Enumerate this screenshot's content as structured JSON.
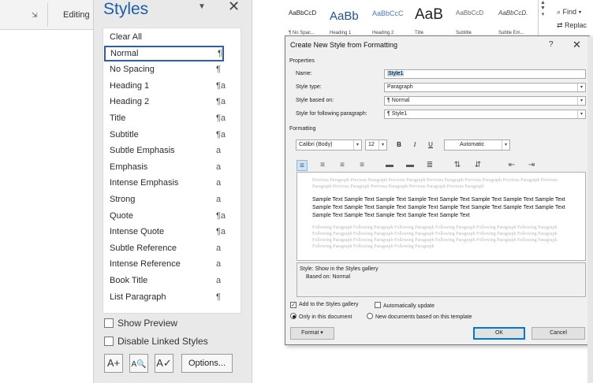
{
  "left_ribbon": {
    "editing_label": "Editing",
    "launcher_icon": "dialog-launcher-icon"
  },
  "styles_pane": {
    "title": "Styles",
    "caret": "▼",
    "close": "✕",
    "items": [
      {
        "label": "Clear All",
        "mark": ""
      },
      {
        "label": "Normal",
        "mark": "¶",
        "selected": true
      },
      {
        "label": "No Spacing",
        "mark": "¶"
      },
      {
        "label": "Heading 1",
        "mark": "¶a"
      },
      {
        "label": "Heading 2",
        "mark": "¶a"
      },
      {
        "label": "Title",
        "mark": "¶a"
      },
      {
        "label": "Subtitle",
        "mark": "¶a"
      },
      {
        "label": "Subtle Emphasis",
        "mark": "a"
      },
      {
        "label": "Emphasis",
        "mark": "a"
      },
      {
        "label": "Intense Emphasis",
        "mark": "a"
      },
      {
        "label": "Strong",
        "mark": "a"
      },
      {
        "label": "Quote",
        "mark": "¶a"
      },
      {
        "label": "Intense Quote",
        "mark": "¶a"
      },
      {
        "label": "Subtle Reference",
        "mark": "a"
      },
      {
        "label": "Intense Reference",
        "mark": "a"
      },
      {
        "label": "Book Title",
        "mark": "a"
      },
      {
        "label": "List Paragraph",
        "mark": "¶"
      }
    ],
    "show_preview": "Show Preview",
    "disable_linked": "Disable Linked Styles",
    "btn_new": "A+",
    "btn_inspect": "A🔍",
    "btn_manage": "A✓",
    "options": "Options..."
  },
  "ribbon": {
    "gallery": [
      {
        "sample": "AaBbCcD",
        "caption": "¶ No Spac..."
      },
      {
        "sample": "AaBb",
        "caption": "Heading 1"
      },
      {
        "sample": "AaBbCcC",
        "caption": "Heading 2"
      },
      {
        "sample": "AaB",
        "caption": "Title"
      },
      {
        "sample": "AaBbCcD",
        "caption": "Subtitle"
      },
      {
        "sample": "AaBbCcD.",
        "caption": "Subtle Em..."
      }
    ],
    "find": "Find",
    "replace": "Replac"
  },
  "dialog": {
    "title": "Create New Style from Formatting",
    "help": "?",
    "close": "✕",
    "properties_label": "Properties",
    "name_label": "Name:",
    "name_value": "Style1",
    "style_type_label": "Style type:",
    "style_type_value": "Paragraph",
    "based_on_label": "Style based on:",
    "based_on_value": "¶ Normal",
    "following_label": "Style for following paragraph:",
    "following_value": "¶ Style1",
    "formatting_label": "Formatting",
    "font": "Calibri (Body)",
    "size": "12",
    "bold": "B",
    "italic": "I",
    "underline": "U",
    "color": "Automatic",
    "prev_para": "Previous Paragraph Previous Paragraph Previous Paragraph Previous Paragraph Previous Paragraph Previous Paragraph Previous Paragraph Previous Paragraph Previous Paragraph Previous Paragraph Previous Paragraph",
    "sample": "Sample Text Sample Text Sample Text Sample Text Sample Text Sample Text Sample Text Sample Text Sample Text Sample Text Sample Text Sample Text Sample Text Sample Text Sample Text Sample Text Sample Text Sample Text Sample Text Sample Text Sample Text",
    "follow_para": "Following Paragraph Following Paragraph Following Paragraph Following Paragraph Following Paragraph Following Paragraph Following Paragraph Following Paragraph Following Paragraph Following Paragraph Following Paragraph Following Paragraph Following Paragraph Following Paragraph Following Paragraph Following Paragraph Following Paragraph Following Paragraph Following Paragraph Following Paragraph Following Paragraph",
    "desc_line1": "Style: Show in the Styles gallery",
    "desc_line2": "Based on: Normal",
    "add_gallery": "Add to the Styles gallery",
    "auto_update": "Automatically update",
    "only_doc": "Only in this document",
    "new_docs": "New documents based on this template",
    "format_btn": "Format ▾",
    "ok": "OK",
    "cancel": "Cancel"
  },
  "colors": {
    "accent": "#1a5ea8",
    "selection": "#2f5f9e",
    "dialog_bg": "#f0f0f0"
  }
}
